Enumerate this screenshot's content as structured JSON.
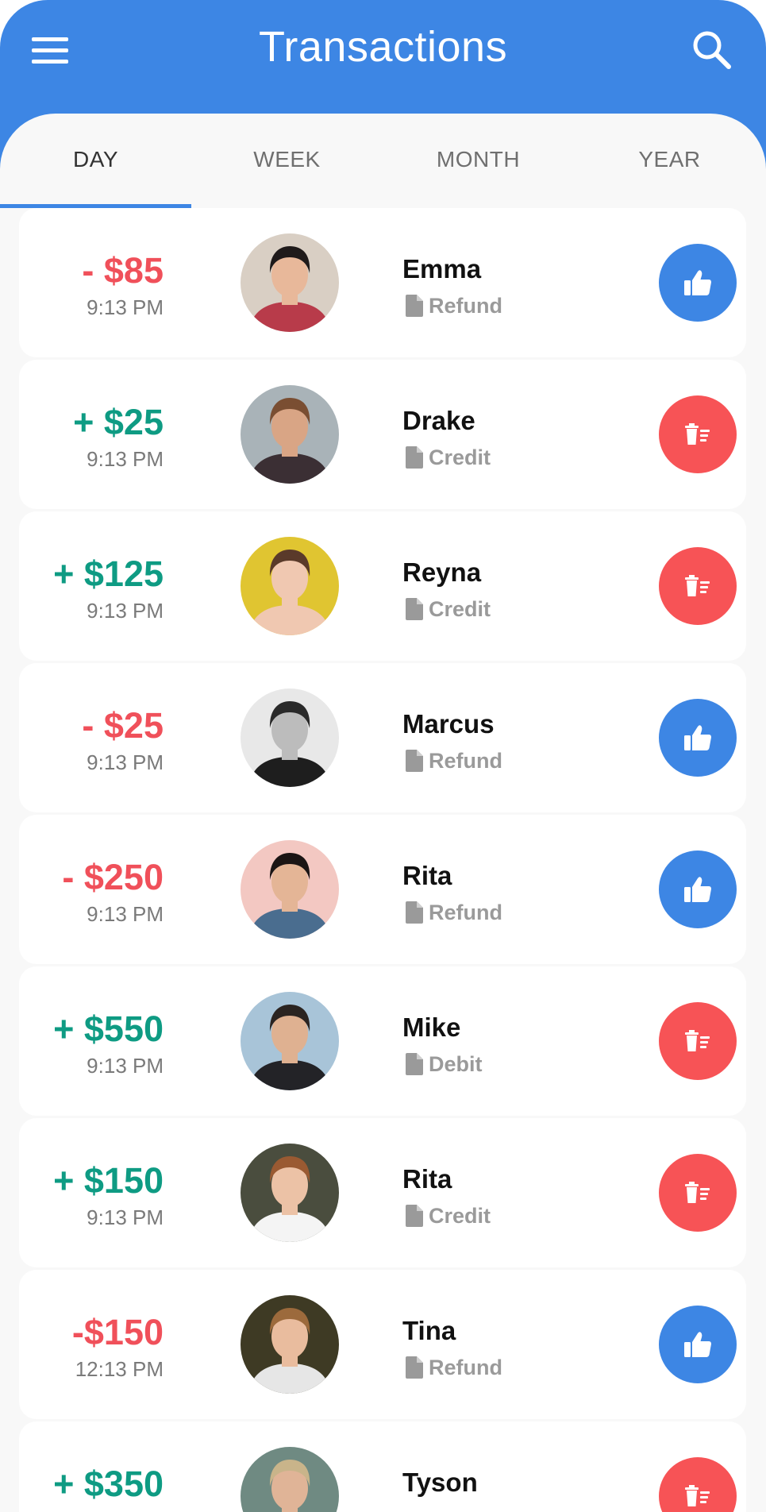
{
  "header": {
    "title": "Transactions"
  },
  "tabs": [
    {
      "label": "DAY",
      "active": true
    },
    {
      "label": "WEEK",
      "active": false
    },
    {
      "label": "MONTH",
      "active": false
    },
    {
      "label": "YEAR",
      "active": false
    }
  ],
  "colors": {
    "primary": "#3d86e4",
    "negative": "#f0505a",
    "positive": "#0e9b83",
    "like_button": "#3d86e4",
    "delete_button": "#f75356"
  },
  "transactions": [
    {
      "amount": "- $85",
      "time": "9:13 PM",
      "name": "Emma",
      "kind": "Refund",
      "sign": "negative",
      "action_icon": "thumbs-up-icon",
      "avatar_bg": "#d9cfc4",
      "avatar_skin": "#e8b89a",
      "avatar_hair": "#1f1a1a",
      "avatar_shirt": "#b83b4a"
    },
    {
      "amount": "+ $25",
      "time": "9:13 PM",
      "name": "Drake",
      "kind": "Credit",
      "sign": "positive",
      "action_icon": "trash-icon",
      "avatar_bg": "#a9b3b8",
      "avatar_skin": "#d9a585",
      "avatar_hair": "#7a4e32",
      "avatar_shirt": "#3b2f34"
    },
    {
      "amount": "+ $125",
      "time": "9:13 PM",
      "name": "Reyna",
      "kind": "Credit",
      "sign": "positive",
      "action_icon": "trash-icon",
      "avatar_bg": "#e0c531",
      "avatar_skin": "#f0c8b1",
      "avatar_hair": "#5a3a2a",
      "avatar_shirt": "#f0c8b1"
    },
    {
      "amount": "- $25",
      "time": "9:13 PM",
      "name": "Marcus",
      "kind": "Refund",
      "sign": "negative",
      "action_icon": "thumbs-up-icon",
      "avatar_bg": "#e8e8e8",
      "avatar_skin": "#bcbcbc",
      "avatar_hair": "#2a2a2a",
      "avatar_shirt": "#1e1e1e"
    },
    {
      "amount": "- $250",
      "time": "9:13 PM",
      "name": "Rita",
      "kind": "Refund",
      "sign": "negative",
      "action_icon": "thumbs-up-icon",
      "avatar_bg": "#f3c8c2",
      "avatar_skin": "#e4b596",
      "avatar_hair": "#1b1514",
      "avatar_shirt": "#4a6d8f"
    },
    {
      "amount": "+ $550",
      "time": "9:13 PM",
      "name": "Mike",
      "kind": "Debit",
      "sign": "positive",
      "action_icon": "trash-icon",
      "avatar_bg": "#a8c4d8",
      "avatar_skin": "#dfb191",
      "avatar_hair": "#2b2421",
      "avatar_shirt": "#232327"
    },
    {
      "amount": "+ $150",
      "time": "9:13 PM",
      "name": "Rita",
      "kind": "Credit",
      "sign": "positive",
      "action_icon": "trash-icon",
      "avatar_bg": "#4a4d3e",
      "avatar_skin": "#ecc2a6",
      "avatar_hair": "#9a5a32",
      "avatar_shirt": "#f4f4f4"
    },
    {
      "amount": "-$150",
      "time": "12:13 PM",
      "name": "Tina",
      "kind": "Refund",
      "sign": "negative",
      "action_icon": "thumbs-up-icon",
      "avatar_bg": "#3e3a24",
      "avatar_skin": "#e9bc9e",
      "avatar_hair": "#9c6a3c",
      "avatar_shirt": "#e6e6e6"
    },
    {
      "amount": "+ $350",
      "time": "",
      "name": "Tyson",
      "kind": "",
      "sign": "positive",
      "action_icon": "trash-icon",
      "avatar_bg": "#6f8a82",
      "avatar_skin": "#e0b497",
      "avatar_hair": "#c9b48a",
      "avatar_shirt": "#2d2d2d"
    }
  ]
}
